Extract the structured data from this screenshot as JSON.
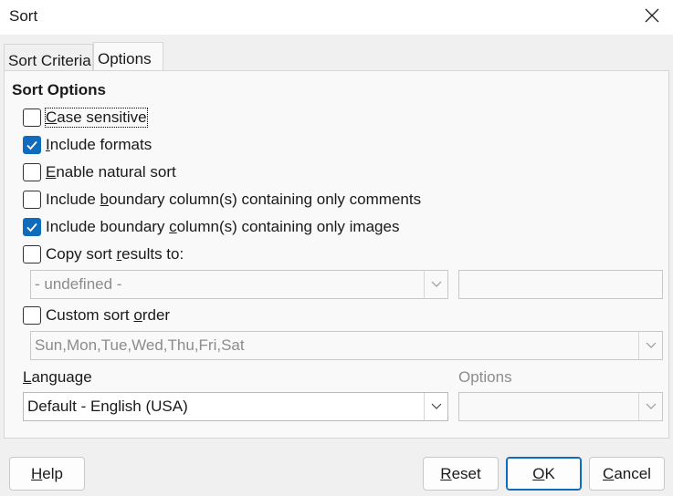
{
  "window": {
    "title": "Sort"
  },
  "tabs": [
    {
      "label": "Sort Criteria",
      "selected": false
    },
    {
      "label": "Options",
      "selected": true
    }
  ],
  "options": {
    "section_title": "Sort Options",
    "checkboxes": [
      {
        "pre": "",
        "u": "C",
        "post": "ase sensitive",
        "checked": false
      },
      {
        "pre": "",
        "u": "I",
        "post": "nclude formats",
        "checked": true
      },
      {
        "pre": "",
        "u": "E",
        "post": "nable natural sort",
        "checked": false
      },
      {
        "pre": "Include ",
        "u": "b",
        "post": "oundary column(s) containing only comments",
        "checked": false
      },
      {
        "pre": "Include boundary ",
        "u": "c",
        "post": "olumn(s) containing only images",
        "checked": true
      },
      {
        "pre": "Copy sort ",
        "u": "r",
        "post": "esults to:",
        "checked": false
      },
      {
        "pre": "Custom sort ",
        "u": "o",
        "post": "rder",
        "checked": false
      }
    ],
    "copy_target_select": "- undefined -",
    "copy_target_input": "",
    "custom_order_select": "Sun,Mon,Tue,Wed,Thu,Fri,Sat",
    "language_label_u": "L",
    "language_label_rest": "anguage",
    "language_value": "Default - English (USA)",
    "options_label": "Options",
    "options_value": ""
  },
  "buttons": {
    "help": {
      "u": "H",
      "rest": "elp"
    },
    "reset": {
      "u": "R",
      "rest": "eset"
    },
    "ok": {
      "u": "O",
      "rest": "K"
    },
    "cancel": {
      "u": "C",
      "rest": "ancel"
    }
  },
  "colors": {
    "accent": "#0f6cbd",
    "disabled_text": "#8c8c8c"
  }
}
